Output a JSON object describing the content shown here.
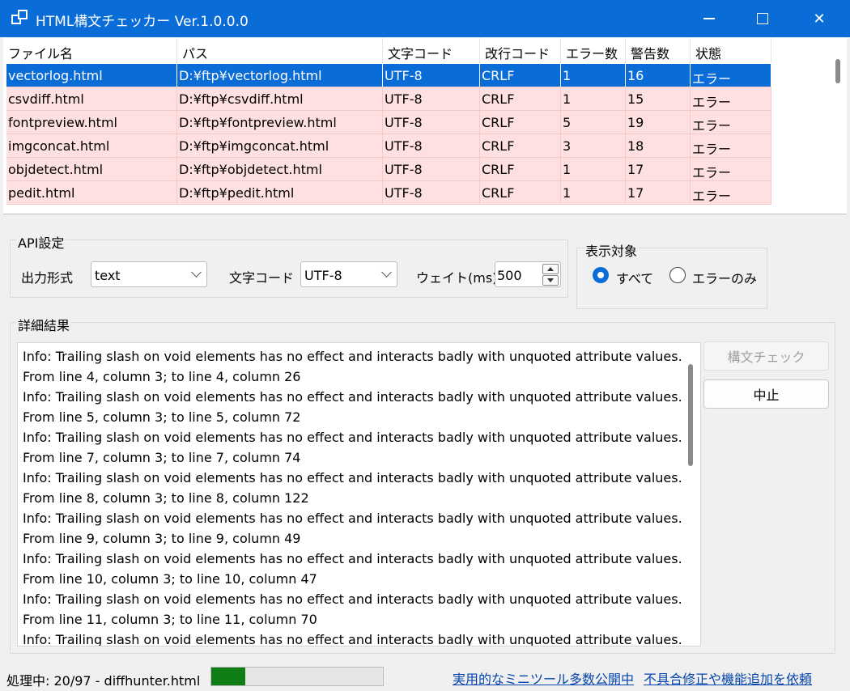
{
  "window": {
    "title": "HTML構文チェッカー Ver.1.0.0.0",
    "accent_color": "#0a6cd6"
  },
  "table": {
    "columns": [
      "ファイル名",
      "パス",
      "文字コード",
      "改行コード",
      "エラー数",
      "警告数",
      "状態"
    ],
    "rows": [
      [
        "vectorlog.html",
        "D:¥ftp¥vectorlog.html",
        "UTF-8",
        "CRLF",
        "1",
        "16",
        "エラー"
      ],
      [
        "csvdiff.html",
        "D:¥ftp¥csvdiff.html",
        "UTF-8",
        "CRLF",
        "1",
        "15",
        "エラー"
      ],
      [
        "fontpreview.html",
        "D:¥ftp¥fontpreview.html",
        "UTF-8",
        "CRLF",
        "5",
        "19",
        "エラー"
      ],
      [
        "imgconcat.html",
        "D:¥ftp¥imgconcat.html",
        "UTF-8",
        "CRLF",
        "3",
        "18",
        "エラー"
      ],
      [
        "objdetect.html",
        "D:¥ftp¥objdetect.html",
        "UTF-8",
        "CRLF",
        "1",
        "17",
        "エラー"
      ],
      [
        "pedit.html",
        "D:¥ftp¥pedit.html",
        "UTF-8",
        "CRLF",
        "1",
        "17",
        "エラー"
      ]
    ],
    "selected_row": 0,
    "error_row_color": "#ffe0e0"
  },
  "api_settings": {
    "group_title": "API設定",
    "output_format_label": "出力形式",
    "output_format_value": "text",
    "encoding_label": "文字コード",
    "encoding_value": "UTF-8",
    "wait_label": "ウェイト(ms)",
    "wait_value": "500"
  },
  "display_target": {
    "group_title": "表示対象",
    "option_all": "すべて",
    "option_errors": "エラーのみ",
    "selected": "すべて"
  },
  "details": {
    "group_title": "詳細結果",
    "lines": [
      "Info: Trailing slash on void elements has no effect and interacts badly with unquoted attribute values.",
      "From line 4, column 3; to line 4, column 26",
      "Info: Trailing slash on void elements has no effect and interacts badly with unquoted attribute values.",
      "From line 5, column 3; to line 5, column 72",
      "Info: Trailing slash on void elements has no effect and interacts badly with unquoted attribute values.",
      "From line 7, column 3; to line 7, column 74",
      "Info: Trailing slash on void elements has no effect and interacts badly with unquoted attribute values.",
      "From line 8, column 3; to line 8, column 122",
      "Info: Trailing slash on void elements has no effect and interacts badly with unquoted attribute values.",
      "From line 9, column 3; to line 9, column 49",
      "Info: Trailing slash on void elements has no effect and interacts badly with unquoted attribute values.",
      "From line 10, column 3; to line 10, column 47",
      "Info: Trailing slash on void elements has no effect and interacts badly with unquoted attribute values.",
      "From line 11, column 3; to line 11, column 70",
      "Info: Trailing slash on void elements has no effect and interacts badly with unquoted attribute values."
    ],
    "check_button": "構文チェック",
    "stop_button": "中止"
  },
  "status": {
    "text": "処理中: 20/97 - diffhunter.html",
    "progress_fraction": 0.2,
    "progress_color": "#0f7d15",
    "link1": "実用的なミニツール多数公開中",
    "link2": "不具合修正や機能追加を依頼"
  }
}
